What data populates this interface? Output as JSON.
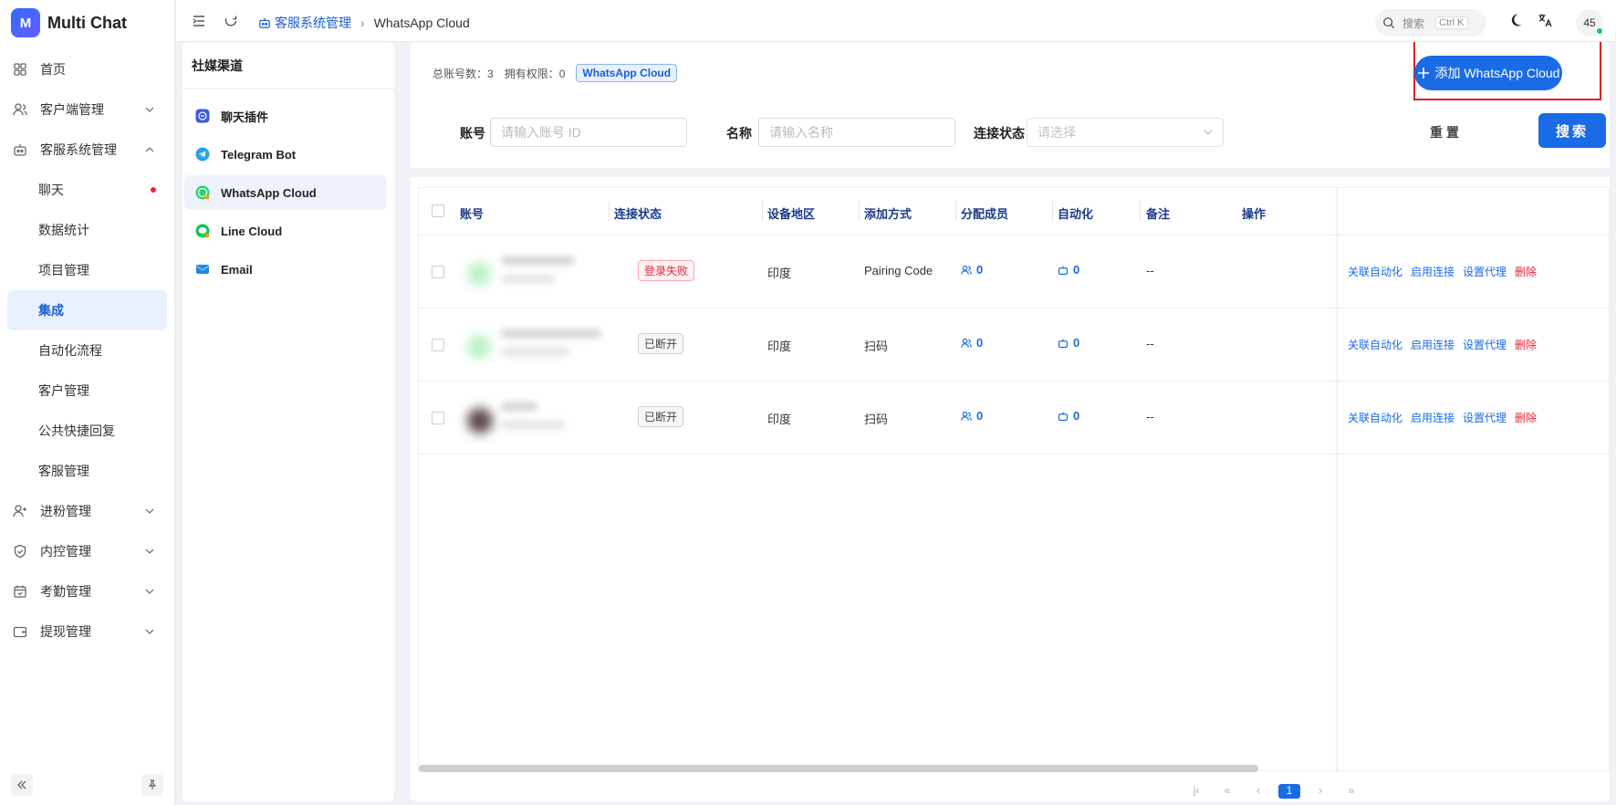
{
  "brand": {
    "logo_letter": "M",
    "name": "Multi Chat"
  },
  "sidebar": {
    "items": [
      {
        "label": "首页",
        "icon": "dashboard-icon"
      },
      {
        "label": "客户端管理",
        "icon": "users-icon",
        "expandable": true
      },
      {
        "label": "客服系统管理",
        "icon": "bot-icon",
        "expanded": true
      },
      {
        "label": "进粉管理",
        "icon": "user-plus-icon",
        "expandable": true
      },
      {
        "label": "内控管理",
        "icon": "shield-icon",
        "expandable": true
      },
      {
        "label": "考勤管理",
        "icon": "calendar-icon",
        "expandable": true
      },
      {
        "label": "提现管理",
        "icon": "wallet-icon",
        "expandable": true
      }
    ],
    "sub_items": [
      {
        "label": "聊天",
        "badge": "dot"
      },
      {
        "label": "数据统计"
      },
      {
        "label": "项目管理"
      },
      {
        "label": "集成",
        "active": true
      },
      {
        "label": "自动化流程"
      },
      {
        "label": "客户管理"
      },
      {
        "label": "公共快捷回复"
      },
      {
        "label": "客服管理"
      }
    ]
  },
  "header": {
    "breadcrumb_parent": "客服系统管理",
    "breadcrumb_current": "WhatsApp Cloud",
    "search_label": "搜索",
    "search_shortcut": "Ctrl K",
    "avatar_text": "45"
  },
  "channels": {
    "title": "社媒渠道",
    "items": [
      {
        "label": "聊天插件",
        "icon": "chat-plugin-icon"
      },
      {
        "label": "Telegram Bot",
        "icon": "telegram-icon"
      },
      {
        "label": "WhatsApp Cloud",
        "icon": "whatsapp-icon",
        "active": true
      },
      {
        "label": "Line Cloud",
        "icon": "line-icon"
      },
      {
        "label": "Email",
        "icon": "email-icon"
      }
    ]
  },
  "summary": {
    "total_label": "总账号数：",
    "total_value": "3",
    "perm_label": "拥有权限：",
    "perm_value": "0",
    "tag": "WhatsApp Cloud"
  },
  "actions": {
    "add_label": "添加 WhatsApp Cloud"
  },
  "filters": {
    "account_label": "账号",
    "account_placeholder": "请输入账号 ID",
    "name_label": "名称",
    "name_placeholder": "请输入名称",
    "status_label": "连接状态",
    "status_placeholder": "请选择",
    "reset_label": "重置",
    "search_label": "搜索"
  },
  "table": {
    "columns": [
      "账号",
      "连接状态",
      "设备地区",
      "添加方式",
      "分配成员",
      "自动化",
      "备注",
      "操作"
    ],
    "rows": [
      {
        "status": "登录失败",
        "status_type": "fail",
        "region": "印度",
        "method": "Pairing Code",
        "members": "0",
        "automation": "0",
        "note": "--"
      },
      {
        "status": "已断开",
        "status_type": "off",
        "region": "印度",
        "method": "扫码",
        "members": "0",
        "automation": "0",
        "note": "--"
      },
      {
        "status": "已断开",
        "status_type": "off",
        "region": "印度",
        "method": "扫码",
        "members": "0",
        "automation": "0",
        "note": "--"
      }
    ],
    "operations": [
      "关联自动化",
      "启用连接",
      "设置代理",
      "删除"
    ]
  },
  "pager": {
    "current_page": "1"
  },
  "colors": {
    "primary": "#1a6be6",
    "danger": "#e5263a",
    "highlight": "#e02020"
  }
}
